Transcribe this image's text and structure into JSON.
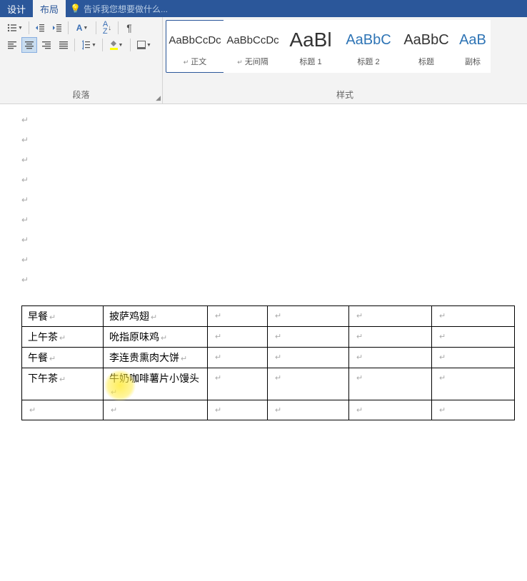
{
  "tabs": {
    "design": "设计",
    "layout": "布局"
  },
  "tell_me": {
    "placeholder": "告诉我您想要做什么..."
  },
  "paragraph": {
    "label": "段落"
  },
  "styles": {
    "label": "样式",
    "items": [
      {
        "preview": "AaBbCcDc",
        "name": "正文",
        "cls": ""
      },
      {
        "preview": "AaBbCcDc",
        "name": "无间隔",
        "cls": ""
      },
      {
        "preview": "AaBl",
        "name": "标题 1",
        "cls": "large"
      },
      {
        "preview": "AaBbC",
        "name": "标题 2",
        "cls": "heading"
      },
      {
        "preview": "AaBbC",
        "name": "标题",
        "cls": "title"
      },
      {
        "preview": "AaB",
        "name": "副标",
        "cls": "heading"
      }
    ]
  },
  "table_data": {
    "rows": [
      [
        "早餐",
        "披萨鸡翅",
        "",
        "",
        "",
        ""
      ],
      [
        "上午茶",
        "吮指原味鸡",
        "",
        "",
        "",
        ""
      ],
      [
        "午餐",
        "李连贵熏肉大饼",
        "",
        "",
        "",
        ""
      ],
      [
        "下午茶",
        "牛奶咖啡薯片小馒头",
        "",
        "",
        "",
        ""
      ],
      [
        "",
        "",
        "",
        "",
        "",
        ""
      ]
    ]
  },
  "para_symbol": "↵"
}
